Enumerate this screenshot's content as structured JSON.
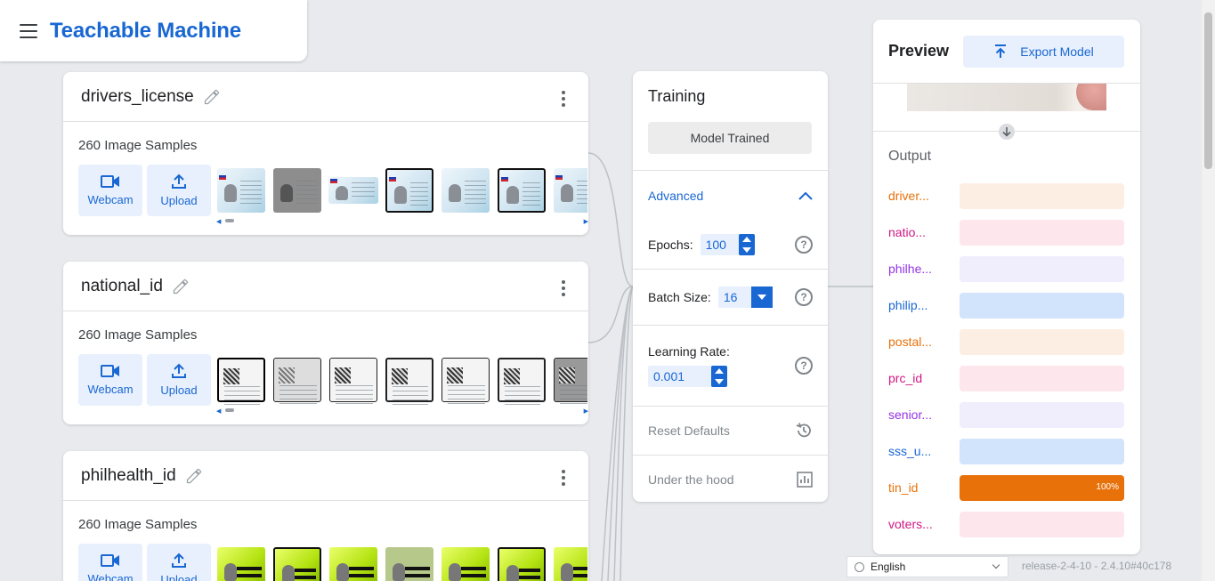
{
  "app": {
    "title": "Teachable Machine"
  },
  "classes": [
    {
      "name": "drivers_license",
      "samples": "260 Image Samples",
      "webcam_label": "Webcam",
      "upload_label": "Upload",
      "thumb_style": "blue"
    },
    {
      "name": "national_id",
      "samples": "260 Image Samples",
      "webcam_label": "Webcam",
      "upload_label": "Upload",
      "thumb_style": "paper"
    },
    {
      "name": "philhealth_id",
      "samples": "260 Image Samples",
      "webcam_label": "Webcam",
      "upload_label": "Upload",
      "thumb_style": "green"
    }
  ],
  "training": {
    "title": "Training",
    "trained_label": "Model Trained",
    "advanced_label": "Advanced",
    "epochs_label": "Epochs:",
    "epochs_value": "100",
    "batch_label": "Batch Size:",
    "batch_value": "16",
    "lr_label": "Learning Rate:",
    "lr_value": "0.001",
    "reset_label": "Reset Defaults",
    "hood_label": "Under the hood",
    "help_glyph": "?"
  },
  "preview": {
    "title": "Preview",
    "export_label": "Export Model",
    "output_title": "Output",
    "outputs": [
      {
        "label": "driver...",
        "color": "#e8710a",
        "bg": "#fdeee3",
        "value": 0,
        "pct": ""
      },
      {
        "label": "natio...",
        "color": "#d01884",
        "bg": "#fde6ec",
        "value": 0,
        "pct": ""
      },
      {
        "label": "philhe...",
        "color": "#9334e6",
        "bg": "#f0edfc",
        "value": 0,
        "pct": ""
      },
      {
        "label": "philip...",
        "color": "#1967d2",
        "bg": "#d2e3fc",
        "value": 0,
        "pct": ""
      },
      {
        "label": "postal...",
        "color": "#e8710a",
        "bg": "#fdeee3",
        "value": 0,
        "pct": ""
      },
      {
        "label": "prc_id",
        "color": "#d01884",
        "bg": "#fde6ec",
        "value": 0,
        "pct": ""
      },
      {
        "label": "senior...",
        "color": "#9334e6",
        "bg": "#f0edfc",
        "value": 0,
        "pct": ""
      },
      {
        "label": "sss_u...",
        "color": "#1967d2",
        "bg": "#d2e3fc",
        "value": 0,
        "pct": ""
      },
      {
        "label": "tin_id",
        "color": "#e8710a",
        "bg": "#fdeee3",
        "value": 1,
        "pct": "100%"
      },
      {
        "label": "voters...",
        "color": "#d01884",
        "bg": "#fde6ec",
        "value": 0,
        "pct": ""
      }
    ]
  },
  "footer": {
    "language": "English",
    "release": "release-2-4-10 - 2.4.10#40c178"
  },
  "colors": {
    "accent": "#1967d2"
  }
}
